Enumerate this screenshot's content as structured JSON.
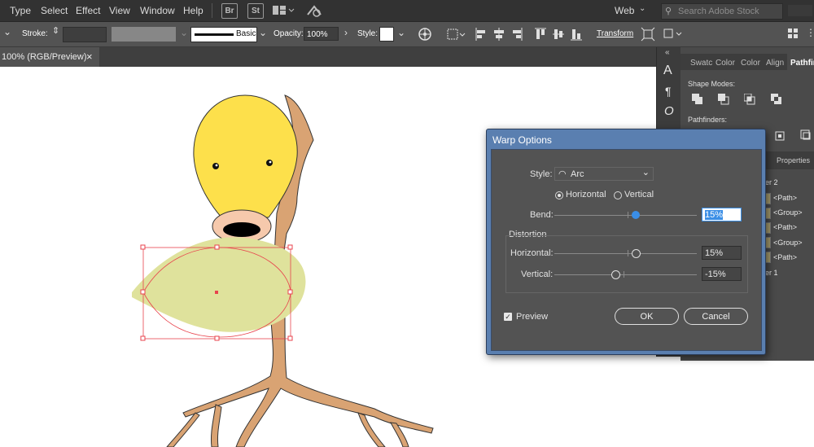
{
  "menu": {
    "items": [
      "Type",
      "Select",
      "Effect",
      "View",
      "Window",
      "Help"
    ],
    "bridge_icon": "Br",
    "stock_icon": "St",
    "workspace": "Web",
    "search_placeholder": "Search Adobe Stock"
  },
  "control_bar": {
    "stroke_label": "Stroke:",
    "brush_label": "Basic",
    "opacity_label": "Opacity:",
    "opacity_value": "100%",
    "style_label": "Style:",
    "transform_label": "Transform"
  },
  "document_tab": {
    "title": "100% (RGB/Preview)",
    "close": "×"
  },
  "panel": {
    "tabs": [
      "Swatc",
      "Color",
      "Color",
      "Align",
      "Pathfin"
    ],
    "shape_modes_label": "Shape Modes:",
    "pathfinders_label": "Pathfinders:",
    "properties_tab": "Properties",
    "layers": [
      "er 2",
      "<Path>",
      "<Group>",
      "<Path>",
      "<Group>",
      "<Path>",
      "er 1"
    ]
  },
  "dialog": {
    "title": "Warp Options",
    "style_label": "Style:",
    "style_value": "Arc",
    "orientation": {
      "horizontal": "Horizontal",
      "vertical": "Vertical",
      "selected": "Horizontal"
    },
    "bend_label": "Bend:",
    "bend_value": "15%",
    "distortion_label": "Distortion",
    "horizontal_label": "Horizontal:",
    "horizontal_value": "15%",
    "vertical_label": "Vertical:",
    "vertical_value": "-15%",
    "preview_label": "Preview",
    "preview_checked": true,
    "ok_label": "OK",
    "cancel_label": "Cancel",
    "accent": "#3a8ee6"
  },
  "colors": {
    "bulb": "#fde04b",
    "leaf": "#dfe29c",
    "stem": "#d9a373",
    "selection": "#e8434d"
  }
}
